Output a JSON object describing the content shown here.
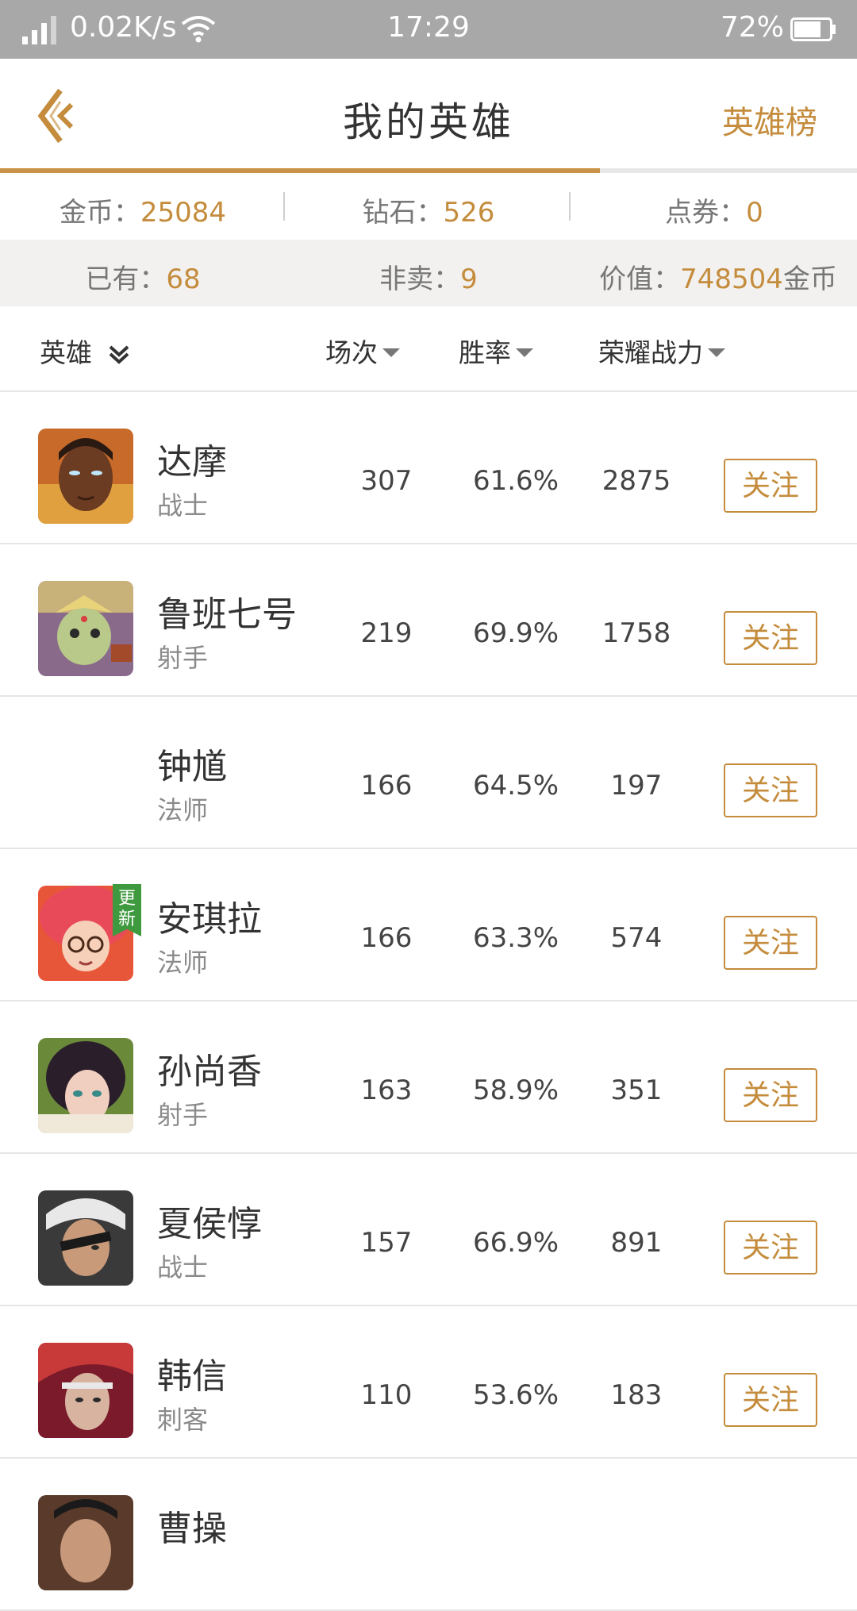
{
  "status_bar": {
    "speed": "0.02K/s",
    "time": "17:29",
    "battery": "72%"
  },
  "header": {
    "title": "我的英雄",
    "rank_link": "英雄榜"
  },
  "currency": {
    "coin_label": "金币：",
    "coin_value": "25084",
    "diamond_label": "钻石：",
    "diamond_value": "526",
    "voucher_label": "点券：",
    "voucher_value": "0"
  },
  "summary": {
    "owned_label": "已有：",
    "owned_value": "68",
    "notsale_label": "非卖：",
    "notsale_value": "9",
    "worth_label": "价值：",
    "worth_value": "748504",
    "worth_unit": "金币"
  },
  "columns": {
    "hero": "英雄",
    "games": "场次",
    "winrate": "胜率",
    "power": "荣耀战力"
  },
  "heroes": [
    {
      "name": "达摩",
      "role": "战士",
      "games": "307",
      "winrate": "61.6%",
      "power": "2875",
      "follow": "关注",
      "badge": ""
    },
    {
      "name": "鲁班七号",
      "role": "射手",
      "games": "219",
      "winrate": "69.9%",
      "power": "1758",
      "follow": "关注",
      "badge": ""
    },
    {
      "name": "钟馗",
      "role": "法师",
      "games": "166",
      "winrate": "64.5%",
      "power": "197",
      "follow": "关注",
      "badge": ""
    },
    {
      "name": "安琪拉",
      "role": "法师",
      "games": "166",
      "winrate": "63.3%",
      "power": "574",
      "follow": "关注",
      "badge": "更新"
    },
    {
      "name": "孙尚香",
      "role": "射手",
      "games": "163",
      "winrate": "58.9%",
      "power": "351",
      "follow": "关注",
      "badge": ""
    },
    {
      "name": "夏侯惇",
      "role": "战士",
      "games": "157",
      "winrate": "66.9%",
      "power": "891",
      "follow": "关注",
      "badge": ""
    },
    {
      "name": "韩信",
      "role": "刺客",
      "games": "110",
      "winrate": "53.6%",
      "power": "183",
      "follow": "关注",
      "badge": ""
    },
    {
      "name": "曹操",
      "role": "",
      "games": "",
      "winrate": "",
      "power": "",
      "follow": "",
      "badge": ""
    }
  ],
  "colors": {
    "accent": "#c48c3c",
    "statusbar": "#a8a8a8",
    "summary_bg": "#f2f1ef"
  }
}
